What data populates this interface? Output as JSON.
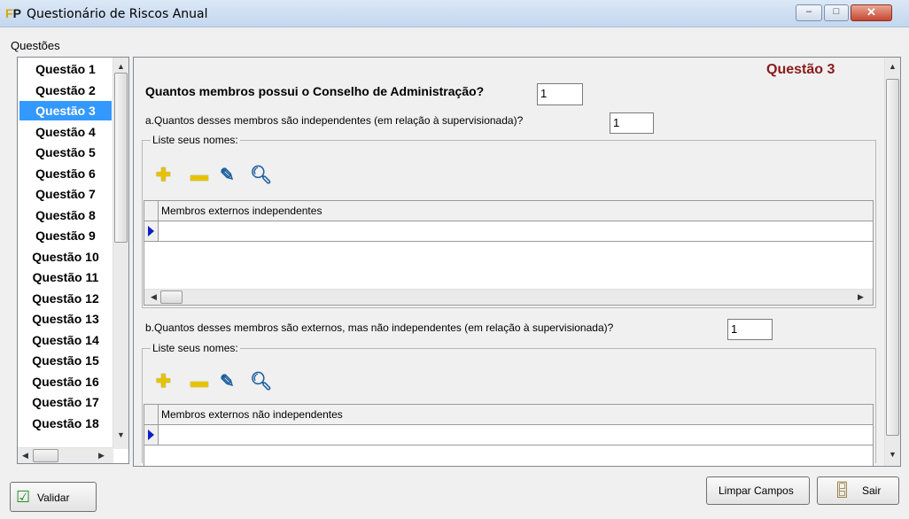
{
  "window": {
    "title": "Questionário de Riscos Anual",
    "min": "–",
    "max": "□",
    "close": "✕"
  },
  "menu": {
    "label": "Questões"
  },
  "questions": [
    "Questão 1",
    "Questão 2",
    "Questão 3",
    "Questão 4",
    "Questão 5",
    "Questão 6",
    "Questão 7",
    "Questão 8",
    "Questão 9",
    "Questão 10",
    "Questão 11",
    "Questão 12",
    "Questão 13",
    "Questão 14",
    "Questão 15",
    "Questão 16",
    "Questão 17",
    "Questão 18"
  ],
  "selected_question": "Questão 3",
  "panel": {
    "heading": "Questão 3",
    "main_question": "Quantos membros possui o Conselho de Administração?",
    "main_value": "1",
    "qa": "a.Quantos desses membros são independentes (em relação à supervisionada)?",
    "qa_value": "1",
    "group_a_label": "Liste seus nomes:",
    "grid_a_col": "Membros externos independentes",
    "qb": "b.Quantos desses membros são externos, mas não independentes (em relação à supervisionada)?",
    "qb_value": "1",
    "group_b_label": "Liste seus nomes:",
    "grid_b_col": "Membros externos não independentes"
  },
  "toolbar_icons": [
    "plus-icon",
    "minus-icon",
    "edit-icon",
    "search-icon"
  ],
  "buttons": {
    "validate": "Validar",
    "clear": "Limpar Campos",
    "exit": "Sair"
  }
}
